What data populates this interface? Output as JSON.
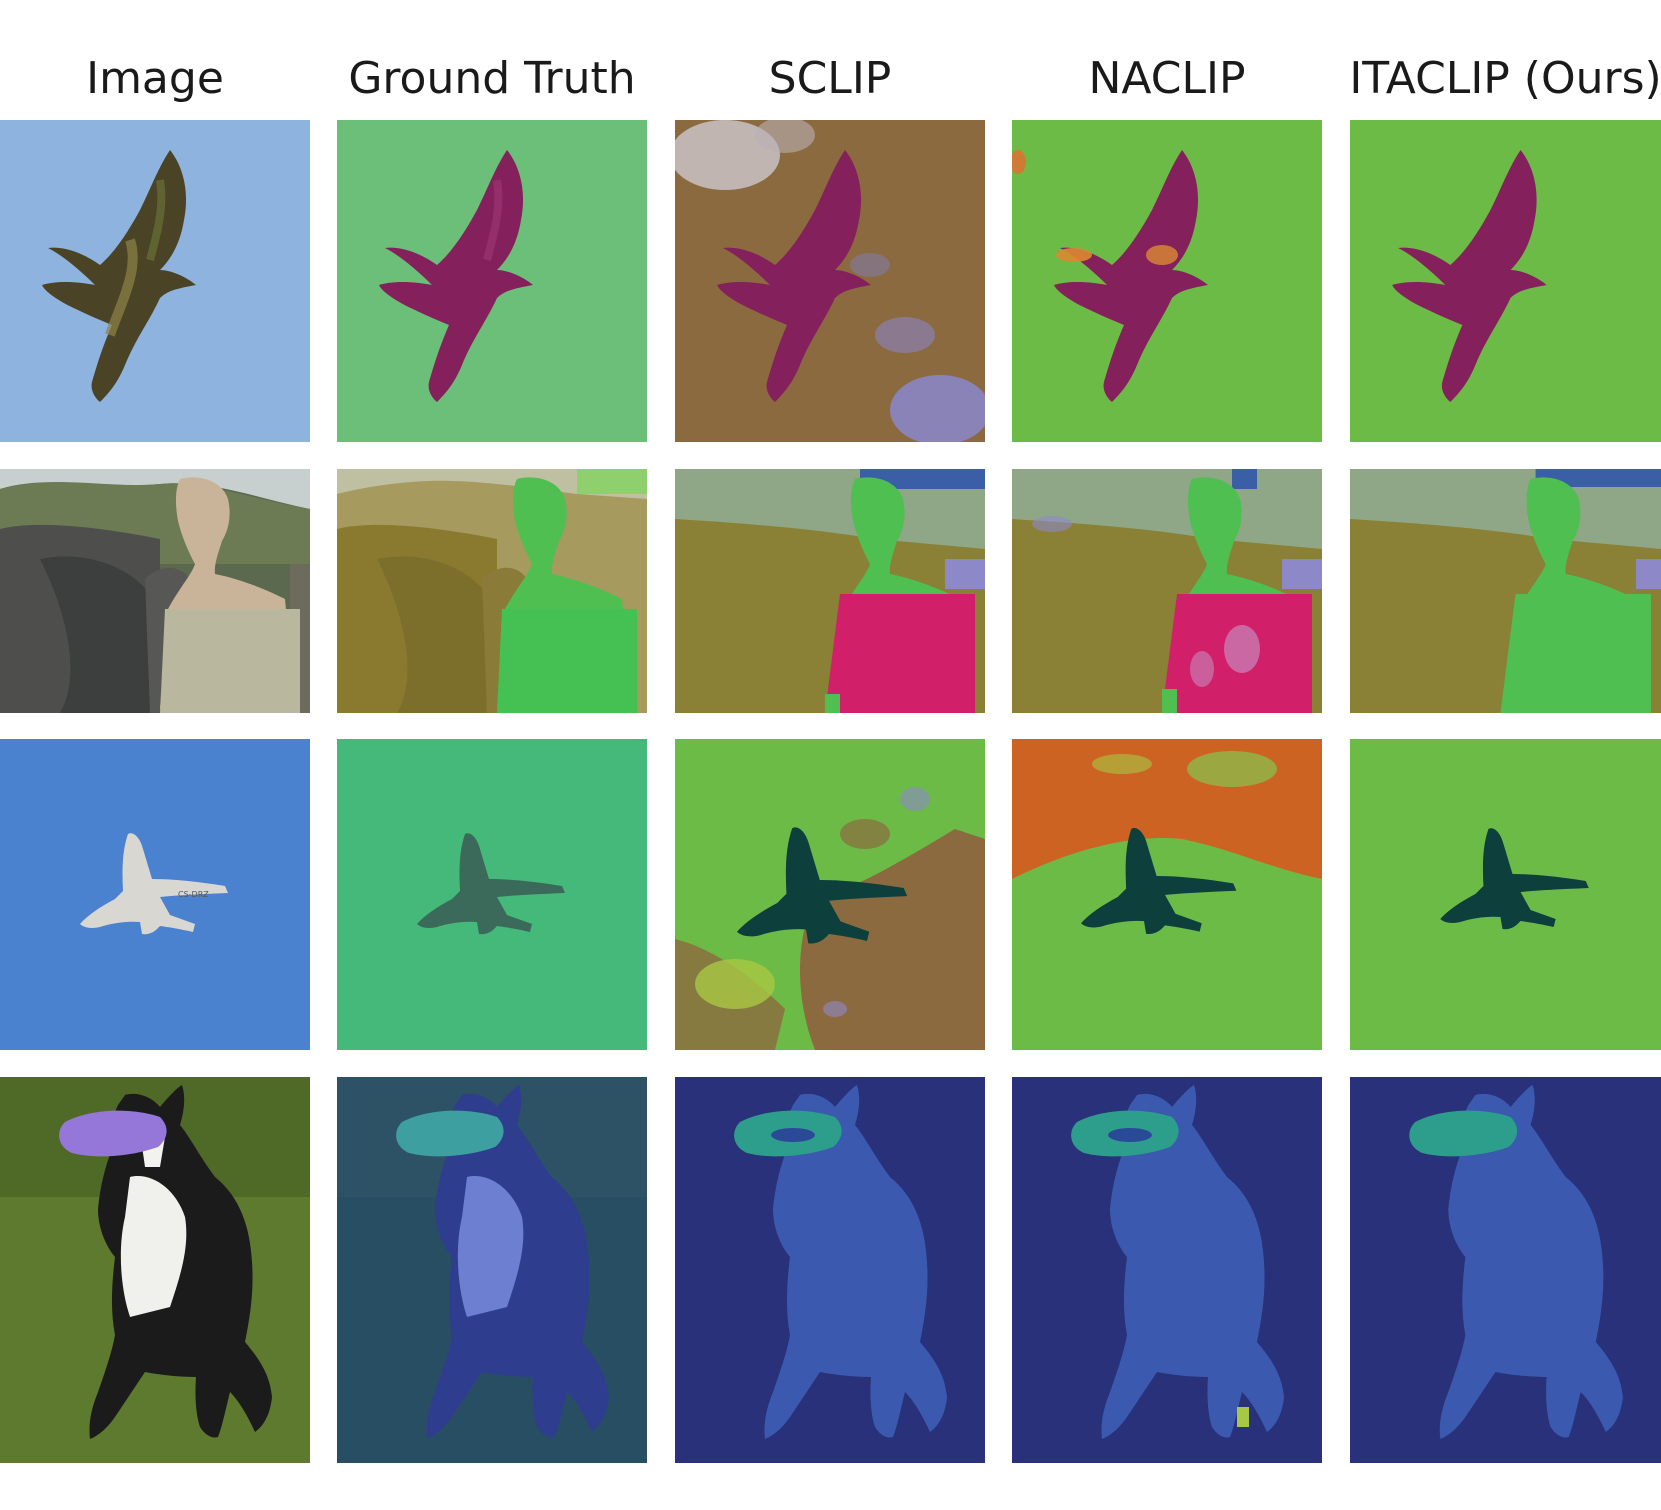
{
  "figure": {
    "columns": [
      {
        "id": "image",
        "label": "Image"
      },
      {
        "id": "ground_truth",
        "label": "Ground Truth"
      },
      {
        "id": "sclip",
        "label": "SCLIP"
      },
      {
        "id": "naclip",
        "label": "NACLIP"
      },
      {
        "id": "itaclip",
        "label": "ITACLIP (Ours)"
      }
    ]
  },
  "colors": {
    "sky_blue": "#8fb3df",
    "gt_green": "#6cbf78",
    "bird_magenta": "#84205c",
    "seg_green": "#6dbb47",
    "sclip_brown": "#8c6a3f",
    "elephant_olive": "#8a8036",
    "person_green": "#4fbf52",
    "shirt_pink": "#d21f6a",
    "plane_dark": "#0d3f3d",
    "naclip_orange": "#cc6322",
    "dog_navy": "#28317a",
    "dog_blue": "#3b5aaf",
    "frisbee_teal": "#2e9e8c"
  }
}
